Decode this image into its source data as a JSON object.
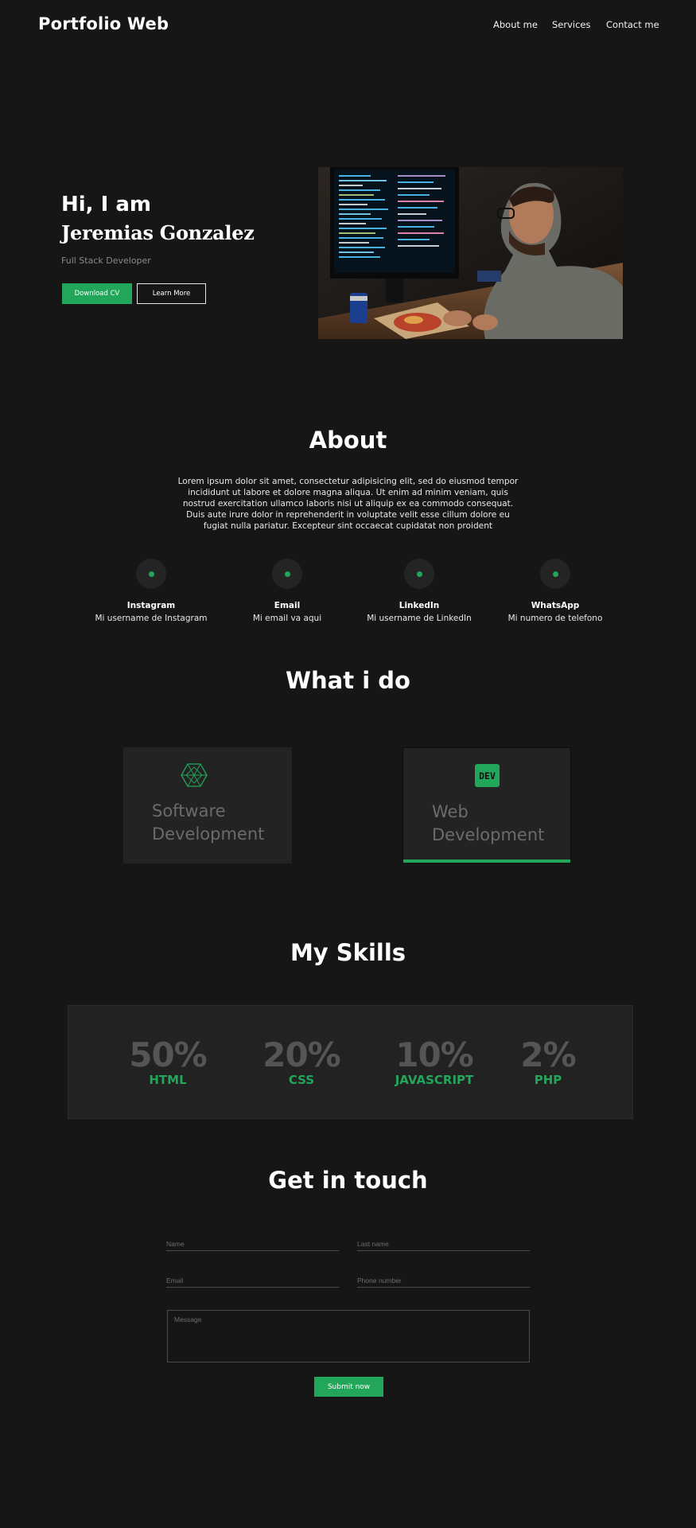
{
  "header": {
    "brand": "Portfolio Web",
    "nav": [
      "About me",
      "Services",
      "Contact me"
    ]
  },
  "hero": {
    "greeting": "Hi, I am",
    "name": "Jeremias Gonzalez",
    "role": "Full Stack Developer",
    "primary_button": "Download CV",
    "secondary_button": "Learn More"
  },
  "about": {
    "title": "About",
    "text": "Lorem ipsum dolor sit amet, consectetur adipisicing elit, sed do eiusmod tempor incididunt ut labore et dolore magna aliqua. Ut enim ad minim veniam, quis nostrud exercitation ullamco laboris nisi ut aliquip ex ea commodo consequat. Duis aute irure dolor in reprehenderit in voluptate velit esse cillum dolore eu fugiat nulla pariatur. Excepteur sint occaecat cupidatat non proident",
    "contacts": [
      {
        "name": "Instagram",
        "detail": "Mi username de Instagram"
      },
      {
        "name": "Email",
        "detail": "Mi email va aqui"
      },
      {
        "name": "LinkedIn",
        "detail": "Mi username de LinkedIn"
      },
      {
        "name": "WhatsApp",
        "detail": "Mi numero de telefono"
      }
    ]
  },
  "services": {
    "title": "What i do",
    "items": [
      {
        "line1": "Software",
        "line2": "Development",
        "icon": "hexagon-outline-icon"
      },
      {
        "line1": "Web",
        "line2": "Development",
        "icon": "dev-badge-icon",
        "badge_text": "DEV"
      }
    ]
  },
  "skills": {
    "title": "My Skills",
    "items": [
      {
        "percent": "50%",
        "name": "HTML"
      },
      {
        "percent": "20%",
        "name": "CSS"
      },
      {
        "percent": "10%",
        "name": "JAVASCRIPT"
      },
      {
        "percent": "2%",
        "name": "PHP"
      }
    ]
  },
  "contact_form": {
    "title": "Get in touch",
    "name_placeholder": "Name",
    "last_name_placeholder": "Last name",
    "email_placeholder": "Email",
    "phone_placeholder": "Phone number",
    "message_placeholder": "Message",
    "submit": "Submit now"
  },
  "colors": {
    "background": "#161616",
    "accent": "#22a65a",
    "card": "#232323",
    "muted_text": "#6b6b6b"
  }
}
